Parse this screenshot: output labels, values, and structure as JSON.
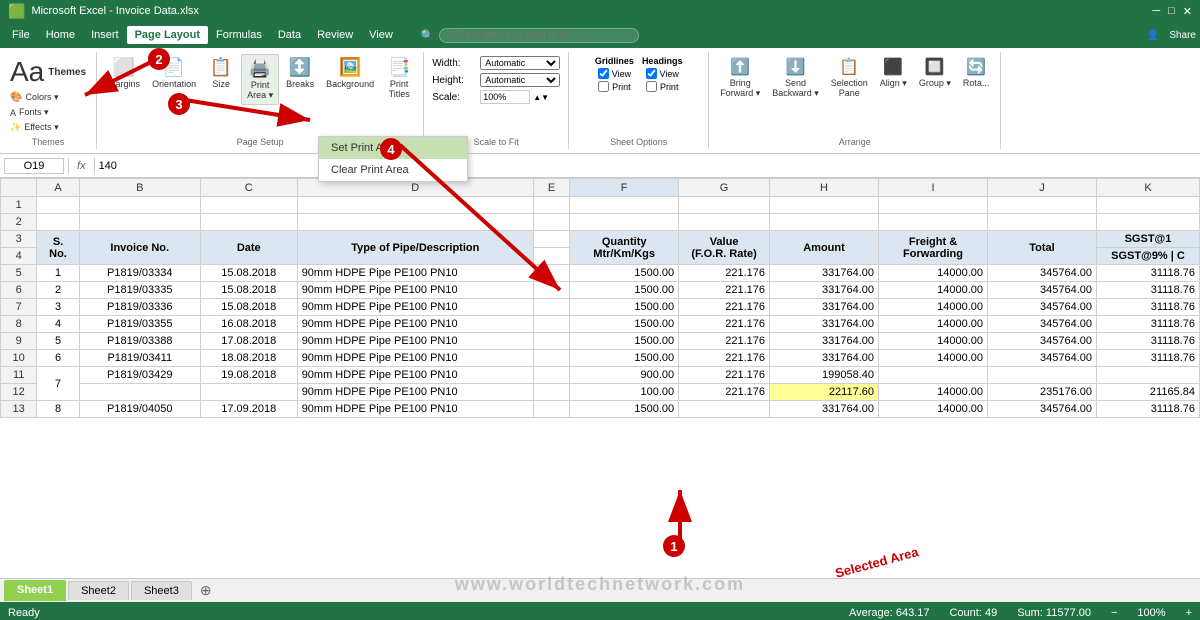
{
  "titleBar": {
    "text": "Microsoft Excel - Invoice Data.xlsx"
  },
  "menuBar": {
    "items": [
      "File",
      "Home",
      "Insert",
      "Page Layout",
      "Formulas",
      "Data",
      "Review",
      "View"
    ],
    "activeItem": "Page Layout",
    "searchPlaceholder": "Tell me what you want to do..."
  },
  "ribbon": {
    "groups": [
      {
        "name": "Themes",
        "label": "Themes",
        "items": [
          "Themes",
          "Colors",
          "Fonts",
          "Effects"
        ]
      },
      {
        "name": "PageSetup",
        "label": "Page Setup",
        "items": [
          "Margins",
          "Orientation",
          "Size",
          "Print Area",
          "Breaks",
          "Background",
          "Print Titles"
        ]
      },
      {
        "name": "ScaleToFit",
        "label": "Scale to Fit",
        "width": "Automatic",
        "height": "Automatic",
        "scale": "100%"
      },
      {
        "name": "SheetOptions",
        "label": "Sheet Options",
        "gridlines_view": true,
        "gridlines_print": false,
        "headings_view": true,
        "headings_print": false
      },
      {
        "name": "Arrange",
        "label": "Arrange",
        "items": [
          "Bring Forward",
          "Send Backward",
          "Selection Pane",
          "Align",
          "Group",
          "Rotate"
        ]
      }
    ],
    "printAreaDropdown": {
      "items": [
        "Set Print Area",
        "Clear Print Area"
      ],
      "selectedItem": "Set Print Area"
    }
  },
  "formulaBar": {
    "cellRef": "O19",
    "formula": "140"
  },
  "columns": [
    "",
    "A",
    "B",
    "C",
    "D",
    "E",
    "F",
    "G",
    "H",
    "I",
    "J",
    "K"
  ],
  "rows": [
    {
      "row": "1",
      "cells": [
        "",
        "",
        "",
        "",
        "",
        "",
        "",
        "",
        "",
        "",
        "",
        ""
      ]
    },
    {
      "row": "2",
      "cells": [
        "",
        "",
        "",
        "",
        "",
        "",
        "",
        "",
        "",
        "",
        "",
        ""
      ]
    },
    {
      "row": "3",
      "cells": [
        "",
        "S.",
        "Invoice No.",
        "Date",
        "Type of Pipe/Description",
        "",
        "Quantity Mtr/Km/Kgs",
        "Value (F.O.R. Rate)",
        "Amount",
        "Freight & Forwarding",
        "Total",
        "SGST@1"
      ]
    },
    {
      "row": "4",
      "cells": [
        "",
        "No.",
        "",
        "",
        "",
        "",
        "",
        "",
        "",
        "",
        "",
        "SGST@9% | C"
      ]
    },
    {
      "row": "5",
      "cells": [
        "",
        "1",
        "P1819/03334",
        "15.08.2018",
        "90mm HDPE Pipe PE100 PN10",
        "",
        "1500.00",
        "221.176",
        "331764.00",
        "14000.00",
        "345764.00",
        "31118.76"
      ]
    },
    {
      "row": "6",
      "cells": [
        "",
        "2",
        "P1819/03335",
        "15.08.2018",
        "90mm HDPE Pipe PE100 PN10",
        "",
        "1500.00",
        "221.176",
        "331764.00",
        "14000.00",
        "345764.00",
        "31118.76"
      ]
    },
    {
      "row": "7",
      "cells": [
        "",
        "3",
        "P1819/03336",
        "15.08.2018",
        "90mm HDPE Pipe PE100 PN10",
        "",
        "1500.00",
        "221.176",
        "331764.00",
        "14000.00",
        "345764.00",
        "31118.76"
      ]
    },
    {
      "row": "8",
      "cells": [
        "",
        "4",
        "P1819/03355",
        "16.08.2018",
        "90mm HDPE Pipe PE100 PN10",
        "",
        "1500.00",
        "221.176",
        "331764.00",
        "14000.00",
        "345764.00",
        "31118.76"
      ]
    },
    {
      "row": "9",
      "cells": [
        "",
        "5",
        "P1819/03388",
        "17.08.2018",
        "90mm HDPE Pipe PE100 PN10",
        "",
        "1500.00",
        "221.176",
        "331764.00",
        "14000.00",
        "345764.00",
        "31118.76"
      ]
    },
    {
      "row": "10",
      "cells": [
        "",
        "6",
        "P1819/03411",
        "18.08.2018",
        "90mm HDPE Pipe PE100 PN10",
        "",
        "1500.00",
        "221.176",
        "331764.00",
        "14000.00",
        "345764.00",
        "31118.76"
      ]
    },
    {
      "row": "11",
      "cells": [
        "",
        "7",
        "P1819/03429",
        "19.08.2018",
        "90mm HDPE Pipe PE100 PN10",
        "",
        "900.00",
        "221.176",
        "199058.40",
        "",
        "",
        ""
      ]
    },
    {
      "row": "12",
      "cells": [
        "",
        "",
        "",
        "",
        "90mm HDPE Pipe PE100 PN10",
        "",
        "100.00",
        "221.176",
        "22117.60",
        "14000.00",
        "235176.00",
        "21165.84"
      ]
    },
    {
      "row": "13",
      "cells": [
        "",
        "8",
        "P1819/04050",
        "17.09.2018",
        "90mm HDPE Pipe PE100 PN10",
        "",
        "1500.00",
        "",
        "331764.00",
        "14000.00",
        "345764.00",
        "31118.76"
      ]
    }
  ],
  "sheetTabs": {
    "tabs": [
      "Sheet1",
      "Sheet2",
      "Sheet3"
    ],
    "activeTab": "Sheet1"
  },
  "statusBar": {
    "ready": "Ready",
    "average": "Average: 643.17",
    "count": "Count: 49",
    "sum": "Sum: 11577.00"
  },
  "annotations": {
    "arrow1": "1",
    "arrow2": "2",
    "arrow3": "3",
    "arrow4": "4",
    "selectedArea": "Selected Area"
  },
  "watermark": "www.worldtechnetwork.com"
}
